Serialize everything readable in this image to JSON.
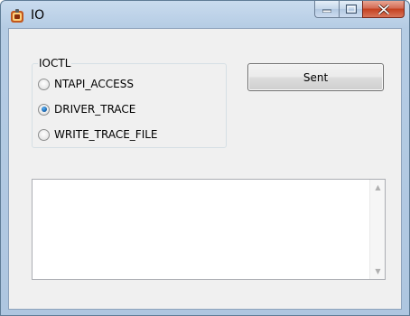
{
  "window": {
    "title": "IO",
    "icon": "app-icon",
    "accent": "#b5cce4",
    "close_color": "#c4401f"
  },
  "ioctl_group": {
    "label": "IOCTL",
    "options": [
      {
        "label": "NTAPI_ACCESS",
        "checked": false
      },
      {
        "label": "DRIVER_TRACE",
        "checked": true
      },
      {
        "label": "WRITE_TRACE_FILE",
        "checked": false
      }
    ]
  },
  "sent_button": {
    "label": "Sent"
  },
  "output": {
    "value": ""
  },
  "scrollbar": {
    "up_icon": "scroll-up-arrow-icon",
    "down_icon": "scroll-down-arrow-icon"
  }
}
